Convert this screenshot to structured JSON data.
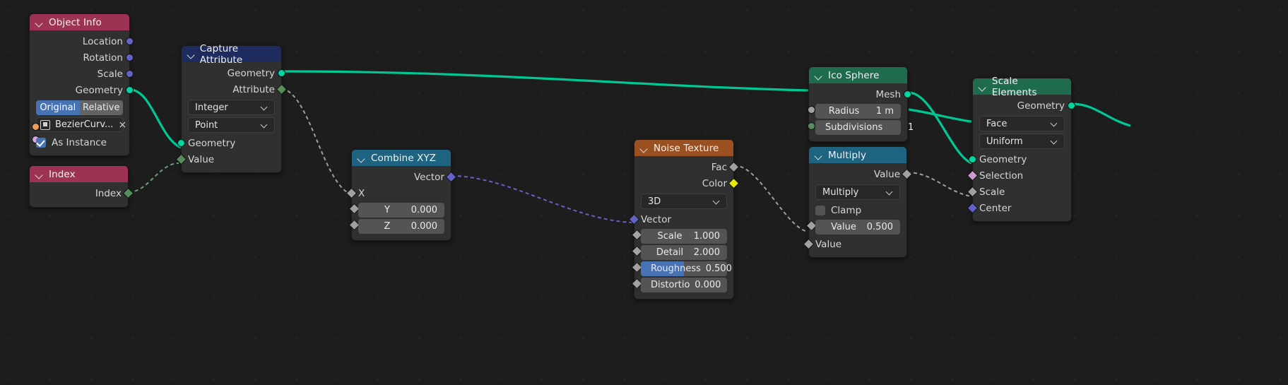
{
  "app": {
    "editor": "Blender Geometry Node Editor"
  },
  "nodes": {
    "object_info": {
      "title": "Object Info",
      "outputs": [
        "Location",
        "Rotation",
        "Scale",
        "Geometry"
      ],
      "toggle_original": "Original",
      "toggle_relative": "Relative",
      "object_name": "BezierCurv...",
      "close_label": "×",
      "as_instance": "As Instance"
    },
    "index": {
      "title": "Index",
      "output": "Index"
    },
    "capture_attribute": {
      "title": "Capture Attribute",
      "outputs": [
        "Geometry",
        "Attribute"
      ],
      "data_type": "Integer",
      "domain": "Point",
      "inputs": [
        "Geometry",
        "Value"
      ]
    },
    "combine_xyz": {
      "title": "Combine XYZ",
      "output": "Vector",
      "x_label": "X",
      "y_label": "Y",
      "y_value": "0.000",
      "z_label": "Z",
      "z_value": "0.000"
    },
    "noise_texture": {
      "title": "Noise Texture",
      "outputs": [
        "Fac",
        "Color"
      ],
      "dimensions": "3D",
      "vector_label": "Vector",
      "fields": [
        {
          "label": "Scale",
          "value": "1.000",
          "fill": 0
        },
        {
          "label": "Detail",
          "value": "2.000",
          "fill": 0
        },
        {
          "label": "Roughness",
          "value": "0.500",
          "fill": 50
        },
        {
          "label": "Distortio",
          "value": "0.000",
          "fill": 0
        }
      ]
    },
    "ico_sphere": {
      "title": "Ico Sphere",
      "output": "Mesh",
      "radius_label": "Radius",
      "radius_value": "1 m",
      "subdivisions_label": "Subdivisions",
      "subdivisions_value": "1"
    },
    "multiply": {
      "title": "Multiply",
      "output": "Value",
      "operation": "Multiply",
      "clamp_label": "Clamp",
      "value_label": "Value",
      "value_value": "0.500",
      "input_label": "Value"
    },
    "scale_elements": {
      "title": "Scale Elements",
      "output": "Geometry",
      "domain": "Face",
      "scale_mode": "Uniform",
      "inputs": [
        "Geometry",
        "Selection",
        "Scale",
        "Center"
      ]
    }
  },
  "colors": {
    "geometry_socket": "#00d6a3",
    "vector_socket": "#6363c7",
    "value_socket": "#a1a1a1",
    "integer_socket": "#598c5c",
    "color_socket": "#e8e800",
    "object_socket": "#ed9e5c",
    "header_geometry": "#1e6b4e",
    "header_input": "#9c3352",
    "header_attribute": "#1d2b5e",
    "header_converter": "#1e6380",
    "header_texture": "#9a5020",
    "accent_blue": "#4772b3"
  }
}
